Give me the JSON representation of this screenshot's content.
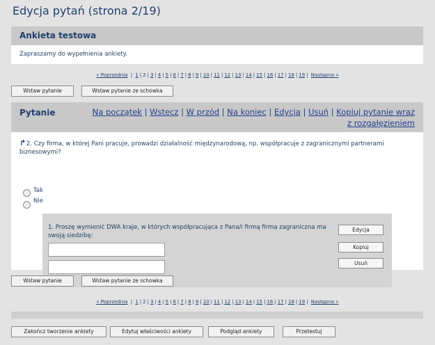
{
  "page": {
    "title": "Edycja pytań (strona 2/19)"
  },
  "survey": {
    "title": "Ankieta testowa",
    "welcome": "Zapraszamy do wypełnienia ankiety."
  },
  "pager": {
    "prev": "« Poprzednia",
    "pages": [
      "1",
      "2",
      "3",
      "4",
      "5",
      "6",
      "7",
      "8",
      "9",
      "10",
      "11",
      "12",
      "13",
      "14",
      "15",
      "16",
      "17",
      "18",
      "19"
    ],
    "current": "2",
    "next": "Następna »"
  },
  "buttons": {
    "insert_question": "Wstaw pytanie",
    "insert_from_clipboard": "Wstaw pytanie ze schowka",
    "finish_survey": "Zakończ tworzenie ankiety",
    "edit_properties": "Edytuj właściwości ankiety",
    "preview": "Podgląd ankiety",
    "test": "Przetestuj"
  },
  "question_panel": {
    "title": "Pytanie",
    "links": {
      "first": "Na początek",
      "back": "Wstecz",
      "forward": "W przód",
      "last": "Na koniec",
      "edit": "Edycja",
      "delete": "Usuń",
      "copy_with_branching": "Kopiuj pytanie wraz z rozgałęzieniem"
    },
    "separator": "|",
    "question": {
      "icon": "branch-arrow-icon",
      "text": "2. Czy firma, w której Pani pracuje, prowadzi działalność międzynarodową, np. współpracuje z zagranicznymi partnerami biznesowymi?",
      "options": [
        "Tak",
        "Nie"
      ]
    },
    "subquestion": {
      "text": "1. Proszę wymienić DWA kraje, w których współpracująca z Pana/i firmą firma zagraniczna ma swoją siedzibę:",
      "inputs": [
        "",
        ""
      ],
      "buttons": {
        "edit": "Edycja",
        "copy": "Kopiuj",
        "delete": "Usuń"
      }
    }
  },
  "colors": {
    "background": "#e3e3e3",
    "header": "#c8c8c8",
    "text": "#1f3f6f",
    "link": "#1f3f8f"
  }
}
